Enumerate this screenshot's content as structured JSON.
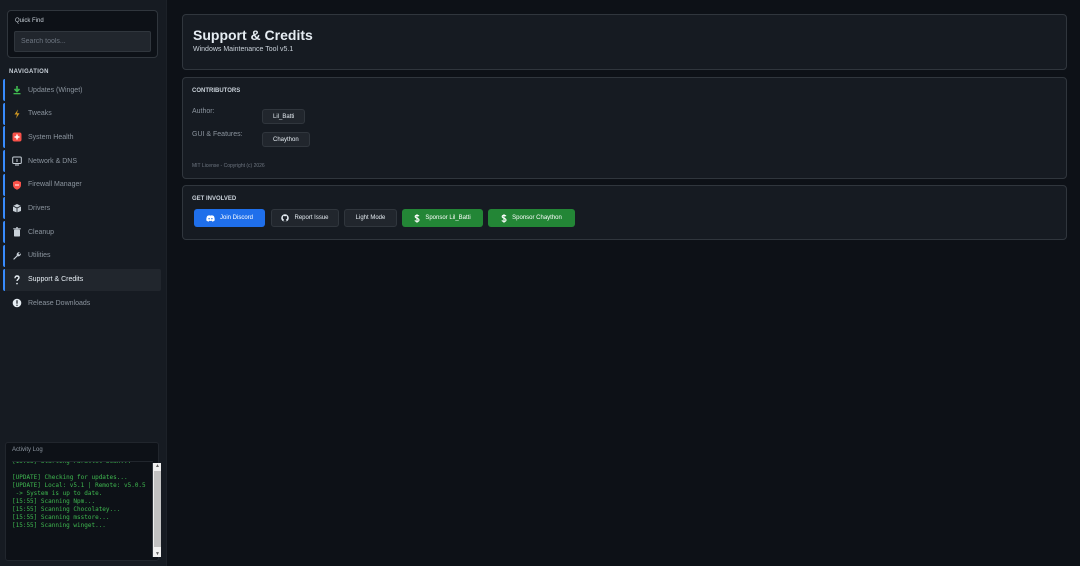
{
  "sidebar": {
    "quick_find_label": "Quick Find",
    "search_placeholder": "Search tools...",
    "nav_heading": "NAVIGATION",
    "items": [
      {
        "label": "Updates (Winget)",
        "icon": "download-icon",
        "color": "#3fb950"
      },
      {
        "label": "Tweaks",
        "icon": "lightning-icon",
        "color": "#d29922"
      },
      {
        "label": "System Health",
        "icon": "health-cross-icon",
        "color": "#f85149"
      },
      {
        "label": "Network & DNS",
        "icon": "network-icon",
        "color": "#c9d1d9"
      },
      {
        "label": "Firewall Manager",
        "icon": "shield-icon",
        "color": "#f85149"
      },
      {
        "label": "Drivers",
        "icon": "driver-box-icon",
        "color": "#c9d1d9"
      },
      {
        "label": "Cleanup",
        "icon": "trash-icon",
        "color": "#c9d1d9"
      },
      {
        "label": "Utilities",
        "icon": "wrench-icon",
        "color": "#c9d1d9"
      },
      {
        "label": "Support & Credits",
        "icon": "question-icon",
        "color": "#e6edf3"
      },
      {
        "label": "Release Downloads",
        "icon": "info-circle-icon",
        "color": "#e6edf3"
      }
    ],
    "active_item": "Support & Credits"
  },
  "activity_log": {
    "title": "Activity Log",
    "text": "[15:55] Starting Parallel Scan...\n\n[UPDATE] Checking for updates...\n[UPDATE] Local: v5.1 | Remote: v5.0.5\n -> System is up to date.\n[15:55] Scanning Npm...\n[15:55] Scanning Chocolatey...\n[15:55] Scanning msstore...\n[15:55] Scanning winget..."
  },
  "header": {
    "title": "Support & Credits",
    "subtitle": "Windows Maintenance Tool v5.1"
  },
  "contributors": {
    "heading": "CONTRIBUTORS",
    "author_label": "Author:",
    "author_name": "Lil_Batti",
    "gui_label": "GUI & Features:",
    "gui_name": "Chaython",
    "license": "MIT License - Copyright (c) 2026"
  },
  "involved": {
    "heading": "GET INVOLVED",
    "discord": "Join Discord",
    "report": "Report Issue",
    "light_mode": "Light Mode",
    "sponsor1": "Sponsor Lil_Batti",
    "sponsor2": "Sponsor Chaython"
  },
  "colors": {
    "background": "#0d1117",
    "panel": "#161b22",
    "accent_blue": "#1f6feb",
    "accent_green": "#238636",
    "log_green": "#3fb950"
  }
}
